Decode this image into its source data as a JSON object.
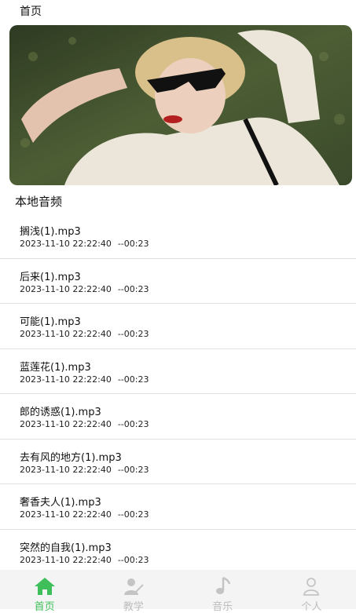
{
  "header": {
    "title": "首页"
  },
  "section_title": "本地音频",
  "audio_list": [
    {
      "name": "搁浅(1).mp3",
      "datetime": "2023-11-10 22:22:40",
      "duration": "--00:23"
    },
    {
      "name": "后来(1).mp3",
      "datetime": "2023-11-10 22:22:40",
      "duration": "--00:23"
    },
    {
      "name": "可能(1).mp3",
      "datetime": "2023-11-10 22:22:40",
      "duration": "--00:23"
    },
    {
      "name": "蓝莲花(1).mp3",
      "datetime": "2023-11-10 22:22:40",
      "duration": "--00:23"
    },
    {
      "name": "郎的诱惑(1).mp3",
      "datetime": "2023-11-10 22:22:40",
      "duration": "--00:23"
    },
    {
      "name": "去有风的地方(1).mp3",
      "datetime": "2023-11-10 22:22:40",
      "duration": "--00:23"
    },
    {
      "name": "奢香夫人(1).mp3",
      "datetime": "2023-11-10 22:22:40",
      "duration": "--00:23"
    },
    {
      "name": "突然的自我(1).mp3",
      "datetime": "2023-11-10 22:22:40",
      "duration": "--00:23"
    }
  ],
  "tabs": [
    {
      "label": "首页",
      "icon": "home-icon",
      "active": true
    },
    {
      "label": "教学",
      "icon": "teaching-icon",
      "active": false
    },
    {
      "label": "音乐",
      "icon": "music-note-icon",
      "active": false
    },
    {
      "label": "个人",
      "icon": "person-icon",
      "active": false
    }
  ],
  "colors": {
    "accent": "#3fbf59",
    "inactive": "#bdbdbd",
    "divider": "#e2e2e2",
    "tabbar_bg": "#f4f4f4"
  }
}
